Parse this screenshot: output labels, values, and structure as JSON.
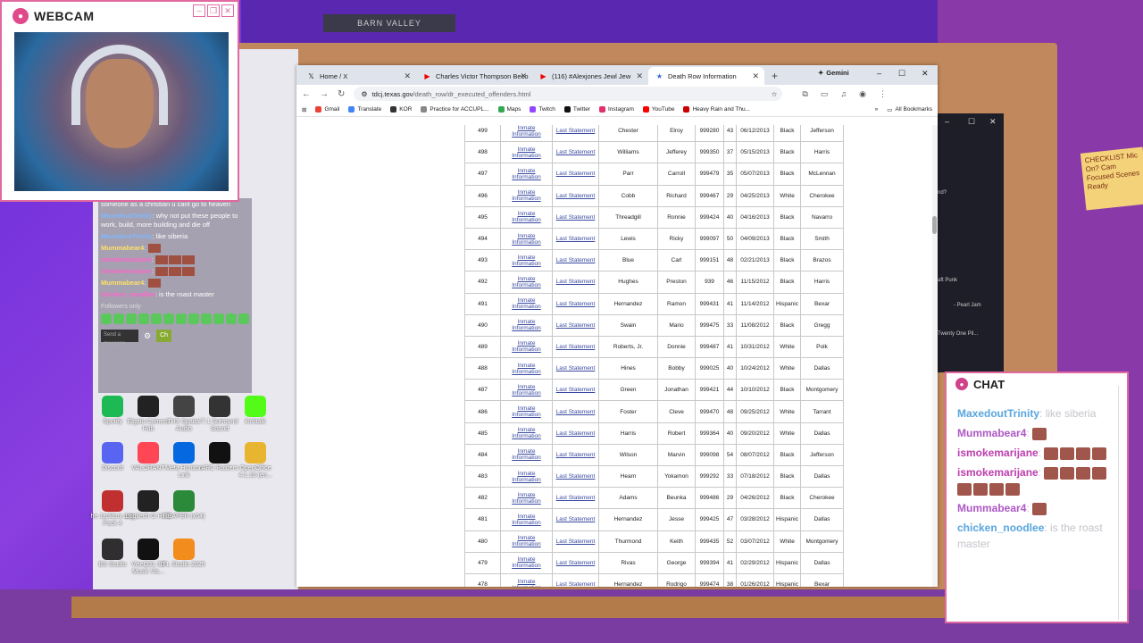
{
  "background": {
    "sign": "BARN VALLEY"
  },
  "webcam": {
    "title": "WEBCAM"
  },
  "stream_chat": {
    "messages": [
      {
        "user": "",
        "text": "someone as a christian u cant go to heaven"
      },
      {
        "user": "MaxedoutTrinity",
        "text": "why not put these people to work, build, more building and die off"
      },
      {
        "user": "MaxedoutTrinity",
        "text": "like siberia"
      },
      {
        "user": "Mummabear4",
        "text": ""
      },
      {
        "user": "ismokemarijane",
        "text": ""
      },
      {
        "user": "ismokemarijane",
        "text": ""
      },
      {
        "user": "Mummabear4",
        "text": ""
      },
      {
        "user": "chicken_noodlee",
        "text": "is the roast master"
      }
    ],
    "followers_only": "Followers only",
    "input_placeholder": "Send a message",
    "chat_button": "Ch"
  },
  "desktop_icons": [
    {
      "label": "Spotify",
      "icon": "spotify-icon",
      "color": "#1db954"
    },
    {
      "label": "Elgato Camera Hub",
      "icon": "elgato-icon",
      "color": "#222222"
    },
    {
      "label": "THX Spatial Audio",
      "icon": "thx-icon",
      "color": "#444444"
    },
    {
      "label": "7.1 Surround Sound",
      "icon": "surround-icon",
      "color": "#333333"
    },
    {
      "label": "kicktalk",
      "icon": "kick-icon",
      "color": "#53fc18"
    },
    {
      "label": "Discord",
      "icon": "discord-icon",
      "color": "#5865f2"
    },
    {
      "label": "VALORANT",
      "icon": "valorant-icon",
      "color": "#ff4655"
    },
    {
      "label": "Meta Horizon Link",
      "icon": "meta-icon",
      "color": "#0668e1"
    },
    {
      "label": "ARC Raiders",
      "icon": "arc-icon",
      "color": "#111111"
    },
    {
      "label": "OpenOffice 4.1.16 (en...",
      "icon": "openoffice-icon",
      "color": "#e8b530"
    },
    {
      "label": "he Jackbox arty Pack 4",
      "icon": "jackbox-icon",
      "color": "#c03030"
    },
    {
      "label": "Logitech G HUB",
      "icon": "ghub-icon",
      "color": "#222222"
    },
    {
      "label": "REAPER (x64)",
      "icon": "reaper-icon",
      "color": "#2a8a3a"
    },
    {
      "label": "BS Studio",
      "icon": "obs-icon",
      "color": "#302e31"
    },
    {
      "label": "ViseQ31 3D Music Vis...",
      "icon": "viseq-icon",
      "color": "#111111"
    },
    {
      "label": "FL Studio 2025",
      "icon": "flstudio-icon",
      "color": "#f28c1c"
    }
  ],
  "browser": {
    "tabs": [
      {
        "label": "Home / X",
        "icon": "x-icon",
        "active": false
      },
      {
        "label": "Charles Victor Thompson Beco",
        "icon": "youtube-icon",
        "active": false
      },
      {
        "label": "(116) #Alexjones Jewl Jew",
        "icon": "youtube-icon",
        "active": false
      },
      {
        "label": "Death Row Information",
        "icon": "star-icon",
        "active": true
      }
    ],
    "gemini": "Gemini",
    "url_domain": "tdcj.texas.gov",
    "url_path": "/death_row/dr_executed_offenders.html",
    "bookmarks": [
      {
        "label": "Gmail",
        "color": "#ea4335"
      },
      {
        "label": "Translate",
        "color": "#4285f4"
      },
      {
        "label": "KOR",
        "color": "#333333"
      },
      {
        "label": "Practice for ACCUPL...",
        "color": "#888888"
      },
      {
        "label": "Maps",
        "color": "#34a853"
      },
      {
        "label": "Twitch",
        "color": "#9146ff"
      },
      {
        "label": "Twitter",
        "color": "#111111"
      },
      {
        "label": "Instagram",
        "color": "#e1306c"
      },
      {
        "label": "YouTube",
        "color": "#ff0000"
      },
      {
        "label": "Heavy Rain and Thu...",
        "color": "#cc0000"
      }
    ],
    "all_bookmarks": "All Bookmarks"
  },
  "table": {
    "link_info": "Inmate Information",
    "link_statement": "Last Statement",
    "rows": [
      [
        "499",
        "Chester",
        "Elroy",
        "999280",
        "43",
        "06/12/2013",
        "Black",
        "Jefferson"
      ],
      [
        "498",
        "Williams",
        "Jefferey",
        "999350",
        "37",
        "05/15/2013",
        "Black",
        "Harris"
      ],
      [
        "497",
        "Parr",
        "Carroll",
        "999479",
        "35",
        "05/07/2013",
        "Black",
        "McLennan"
      ],
      [
        "496",
        "Cobb",
        "Richard",
        "999467",
        "29",
        "04/25/2013",
        "White",
        "Cherokee"
      ],
      [
        "495",
        "Threadgill",
        "Ronnie",
        "999424",
        "40",
        "04/16/2013",
        "Black",
        "Navarro"
      ],
      [
        "494",
        "Lewis",
        "Ricky",
        "999097",
        "50",
        "04/09/2013",
        "Black",
        "Smith"
      ],
      [
        "493",
        "Blue",
        "Carl",
        "999151",
        "48",
        "02/21/2013",
        "Black",
        "Brazos"
      ],
      [
        "492",
        "Hughes",
        "Preston",
        "939",
        "46",
        "11/15/2012",
        "Black",
        "Harris"
      ],
      [
        "491",
        "Hernandez",
        "Ramon",
        "999431",
        "41",
        "11/14/2012",
        "Hispanic",
        "Bexar"
      ],
      [
        "490",
        "Swain",
        "Mario",
        "999475",
        "33",
        "11/08/2012",
        "Black",
        "Gregg"
      ],
      [
        "489",
        "Roberts, Jr.",
        "Donnie",
        "999487",
        "41",
        "10/31/2012",
        "White",
        "Polk"
      ],
      [
        "488",
        "Hines",
        "Bobby",
        "999025",
        "40",
        "10/24/2012",
        "White",
        "Dallas"
      ],
      [
        "487",
        "Green",
        "Jonathan",
        "999421",
        "44",
        "10/10/2012",
        "Black",
        "Montgomery"
      ],
      [
        "486",
        "Foster",
        "Cleve",
        "999470",
        "48",
        "09/25/2012",
        "White",
        "Tarrant"
      ],
      [
        "485",
        "Harris",
        "Robert",
        "999364",
        "40",
        "09/20/2012",
        "White",
        "Dallas"
      ],
      [
        "484",
        "Wilson",
        "Marvin",
        "999098",
        "54",
        "08/07/2012",
        "Black",
        "Jefferson"
      ],
      [
        "483",
        "Hearn",
        "Yokamon",
        "999292",
        "33",
        "07/18/2012",
        "Black",
        "Dallas"
      ],
      [
        "482",
        "Adams",
        "Beunka",
        "999486",
        "29",
        "04/26/2012",
        "Black",
        "Cherokee"
      ],
      [
        "481",
        "Hernandez",
        "Jesse",
        "999425",
        "47",
        "03/28/2012",
        "Hispanic",
        "Dallas"
      ],
      [
        "480",
        "Thurmond",
        "Keith",
        "999435",
        "52",
        "03/07/2012",
        "White",
        "Montgomery"
      ],
      [
        "479",
        "Rivas",
        "George",
        "999394",
        "41",
        "02/29/2012",
        "Hispanic",
        "Dallas"
      ],
      [
        "478",
        "Hernandez",
        "Rodrigo",
        "999474",
        "38",
        "01/26/2012",
        "Hispanic",
        "Bexar"
      ]
    ]
  },
  "bg_window": {
    "lines": [
      "nd?",
      "aft Punk",
      "- Pearl Jam",
      "Twenty One Pil..."
    ]
  },
  "chat_widget": {
    "title": "CHAT",
    "messages": [
      {
        "user": "MaxedoutTrinity",
        "text": "like siberia"
      },
      {
        "user": "Mummabear4",
        "text": ""
      },
      {
        "user": "ismokemarijane",
        "text": ""
      },
      {
        "user": "ismokemarijane",
        "text": ""
      },
      {
        "user": "Mummabear4",
        "text": ""
      },
      {
        "user": "chicken_noodlee",
        "text": "is the roast master"
      }
    ]
  },
  "sticky_note": "CHECKLIST Mic On? Cam Focused Scenes Ready"
}
